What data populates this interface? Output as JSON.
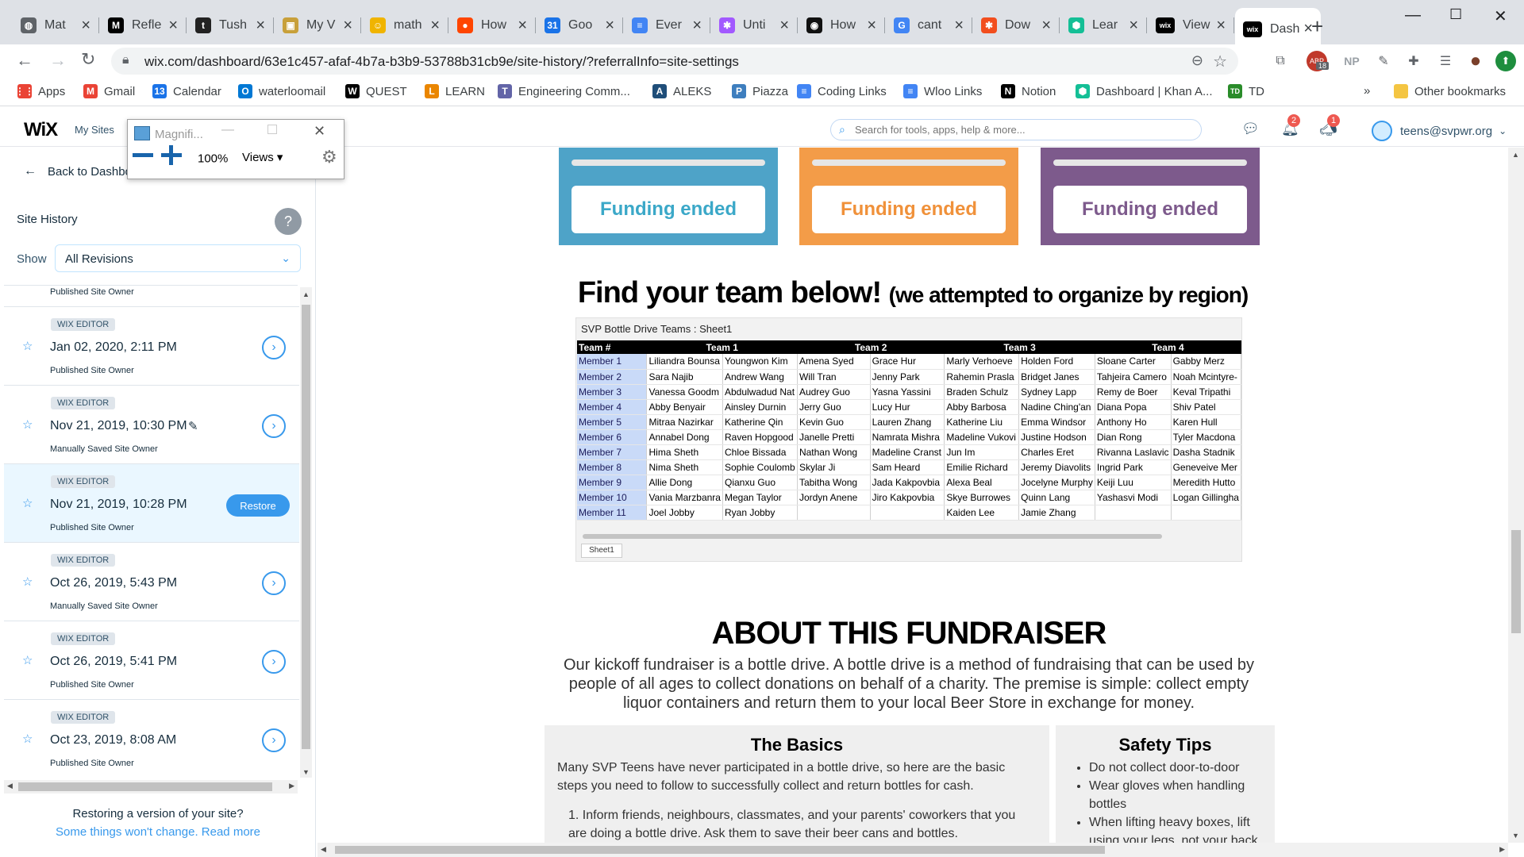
{
  "browser": {
    "tabs": [
      {
        "label": "Mat",
        "icon": "globe-icon",
        "color": "#5f6368",
        "glyph": "◍"
      },
      {
        "label": "Refle",
        "icon": "medium-icon",
        "color": "#000000",
        "glyph": "M"
      },
      {
        "label": "Tush",
        "icon": "tg-icon",
        "color": "#222222",
        "glyph": "t"
      },
      {
        "label": "My V",
        "icon": "photo-icon",
        "color": "#c8a03a",
        "glyph": "▣"
      },
      {
        "label": "math",
        "icon": "emoji-icon",
        "color": "#f0b400",
        "glyph": "☺"
      },
      {
        "label": "How",
        "icon": "reddit-icon",
        "color": "#ff4500",
        "glyph": "●"
      },
      {
        "label": "Goo",
        "icon": "calendar-icon",
        "color": "#1a73e8",
        "glyph": "31"
      },
      {
        "label": "Ever",
        "icon": "docs-icon",
        "color": "#4285f4",
        "glyph": "≡"
      },
      {
        "label": "Unti",
        "icon": "figma-icon",
        "color": "#a259ff",
        "glyph": "✱"
      },
      {
        "label": "How",
        "icon": "github-icon",
        "color": "#111111",
        "glyph": "◉"
      },
      {
        "label": "cant",
        "icon": "google-icon",
        "color": "#4285f4",
        "glyph": "G"
      },
      {
        "label": "Dow",
        "icon": "figma-icon",
        "color": "#f24e1e",
        "glyph": "✱"
      },
      {
        "label": "Lear",
        "icon": "khan-icon",
        "color": "#14bf96",
        "glyph": "⬢"
      },
      {
        "label": "View",
        "icon": "wix-icon",
        "color": "#000000",
        "glyph": "wix"
      },
      {
        "label": "Dash",
        "icon": "wix-icon",
        "color": "#000000",
        "glyph": "wix",
        "active": true
      }
    ],
    "url": "wix.com/dashboard/63e1c457-afaf-4b7a-b3b9-53788b31cb9e/site-history/?referralInfo=site-settings",
    "extensions": [
      {
        "name": "profile-icon",
        "glyph": "⧉"
      },
      {
        "name": "abp-icon",
        "glyph": "ABP",
        "badge": "18"
      },
      {
        "name": "np-icon",
        "glyph": "NP"
      },
      {
        "name": "pen-icon",
        "glyph": "✎"
      },
      {
        "name": "puzzle-icon",
        "glyph": "✚"
      },
      {
        "name": "reading-list-icon",
        "glyph": "☰"
      },
      {
        "name": "avatar-icon",
        "glyph": "●"
      },
      {
        "name": "update-icon",
        "glyph": "⬆"
      }
    ],
    "bookmarks": [
      {
        "label": "Apps",
        "icon": "apps-icon",
        "color": "#ea4335",
        "glyph": "⋮⋮"
      },
      {
        "label": "Gmail",
        "icon": "gmail-icon",
        "color": "#ea4335",
        "glyph": "M"
      },
      {
        "label": "Calendar",
        "icon": "calendar-icon",
        "color": "#1a73e8",
        "glyph": "13"
      },
      {
        "label": "waterloomail",
        "icon": "outlook-icon",
        "color": "#0078d4",
        "glyph": "O"
      },
      {
        "label": "QUEST",
        "icon": "w-icon",
        "color": "#000000",
        "glyph": "W"
      },
      {
        "label": "LEARN",
        "icon": "learn-icon",
        "color": "#ea8600",
        "glyph": "L"
      },
      {
        "label": "Engineering Comm...",
        "icon": "teams-icon",
        "color": "#6264a7",
        "glyph": "T"
      },
      {
        "label": "ALEKS",
        "icon": "aleks-icon",
        "color": "#1f4e79",
        "glyph": "A"
      },
      {
        "label": "Piazza",
        "icon": "piazza-icon",
        "color": "#3e7ebe",
        "glyph": "P"
      },
      {
        "label": "Coding Links",
        "icon": "docs-icon",
        "color": "#4285f4",
        "glyph": "≡"
      },
      {
        "label": "Wloo Links",
        "icon": "docs-icon",
        "color": "#4285f4",
        "glyph": "≡"
      },
      {
        "label": "Notion",
        "icon": "notion-icon",
        "color": "#000000",
        "glyph": "N"
      },
      {
        "label": "Dashboard | Khan A...",
        "icon": "khan-icon",
        "color": "#14bf96",
        "glyph": "⬢"
      },
      {
        "label": "TD",
        "icon": "td-icon",
        "color": "#2a8c2a",
        "glyph": "TD"
      }
    ],
    "other_bookmarks": "Other bookmarks"
  },
  "wix": {
    "logo": "WiX",
    "my_sites": "My Sites",
    "search_placeholder": "Search for tools, apps, help & more...",
    "notifications_badge": "2",
    "messages_badge": "1",
    "user": "teens@svpwr.org"
  },
  "left_panel": {
    "back": "Back to Dashboard",
    "title": "Site History",
    "help": "?",
    "show_label": "Show",
    "show_value": "All Revisions",
    "top_stub": "Published Site Owner",
    "revisions": [
      {
        "tag": "WIX EDITOR",
        "date": "Jan 02, 2020, 2:11 PM",
        "sub": "Published Site Owner",
        "action": "go"
      },
      {
        "tag": "WIX EDITOR",
        "date": "Nov 21, 2019, 10:30 PM",
        "sub": "Manually Saved Site Owner",
        "action": "go",
        "edit": true
      },
      {
        "tag": "WIX EDITOR",
        "date": "Nov 21, 2019, 10:28 PM",
        "sub": "Published Site Owner",
        "action": "restore",
        "highlight": true
      },
      {
        "tag": "WIX EDITOR",
        "date": "Oct 26, 2019, 5:43 PM",
        "sub": "Manually Saved Site Owner",
        "action": "go"
      },
      {
        "tag": "WIX EDITOR",
        "date": "Oct 26, 2019, 5:41 PM",
        "sub": "Published Site Owner",
        "action": "go"
      },
      {
        "tag": "WIX EDITOR",
        "date": "Oct 23, 2019, 8:08 AM",
        "sub": "Published Site Owner",
        "action": "go"
      }
    ],
    "restore_label": "Restore",
    "footer_q": "Restoring a version of your site?",
    "footer_link": "Some things won't change. Read more"
  },
  "magnifier": {
    "title": "Magnifi...",
    "zoom": "100%",
    "views": "Views ▾"
  },
  "page": {
    "funding": [
      {
        "label": "Funding ended",
        "color": "#4ea3c8",
        "text_color": "#3ba8c8"
      },
      {
        "label": "Funding ended",
        "color": "#f39c48",
        "text_color": "#f0913a"
      },
      {
        "label": "Funding ended",
        "color": "#7d5a8c",
        "text_color": "#7d5a8c"
      }
    ],
    "find_team": "Find your team below!",
    "find_team_note": "(we attempted to organize by region)",
    "sheet_title": "SVP Bottle Drive Teams : Sheet1",
    "sheet_tab": "Sheet1",
    "table": {
      "headers": [
        "Team #",
        "Team 1",
        "",
        "Team 2",
        "",
        "Team 3",
        "",
        "Team 4",
        ""
      ],
      "rows": [
        [
          "Member 1",
          "Liliandra Bounsa",
          "Youngwon Kim",
          "Amena Syed",
          "Grace Hur",
          "Marly Verhoeve",
          "Holden Ford",
          "Sloane Carter",
          "Gabby Merz"
        ],
        [
          "Member 2",
          "Sara Najib",
          "Andrew Wang",
          "Will Tran",
          "Jenny Park",
          "Rahemin Prasla",
          "Bridget Janes",
          "Tahjeira Camero",
          "Noah Mcintyre-"
        ],
        [
          "Member 3",
          "Vanessa Goodm",
          "Abdulwadud Nat",
          "Audrey Guo",
          "Yasna Yassini",
          "Braden Schulz",
          "Sydney Lapp",
          "Remy de Boer",
          "Keval Tripathi"
        ],
        [
          "Member 4",
          "Abby Benyair",
          "Ainsley Durnin",
          "Jerry Guo",
          "Lucy Hur",
          "Abby Barbosa",
          "Nadine Ching'an",
          "Diana Popa",
          "Shiv Patel"
        ],
        [
          "Member 5",
          "Mitraa Nazirkar",
          "Katherine Qin",
          "Kevin Guo",
          "Lauren Zhang",
          "Katherine Liu",
          "Emma Windsor",
          "Anthony Ho",
          "Karen Hull"
        ],
        [
          "Member 6",
          "Annabel Dong",
          "Raven Hopgood",
          "Janelle Pretti",
          "Namrata Mishra",
          "Madeline Vukovi",
          "Justine Hodson",
          "Dian Rong",
          "Tyler Macdona"
        ],
        [
          "Member 7",
          "Hima Sheth",
          "Chloe Bissada",
          "Nathan Wong",
          "Madeline Cranst",
          "Jun Im",
          "Charles Eret",
          "Rivanna Laslavic",
          "Dasha Stadnik"
        ],
        [
          "Member 8",
          "Nima Sheth",
          "Sophie Coulomb",
          "Skylar Ji",
          "Sam Heard",
          "Emilie Richard",
          "Jeremy Diavolits",
          "Ingrid Park",
          "Geneveive Mer"
        ],
        [
          "Member 9",
          "Allie Dong",
          "Qianxu Guo",
          "Tabitha Wong",
          "Jada Kakpovbia",
          "Alexa Beal",
          "Jocelyne Murphy",
          "Keiji Luu",
          "Meredith Hutto"
        ],
        [
          "Member 10",
          "Vania Marzbanra",
          "Megan Taylor",
          "Jordyn Anene",
          "Jiro Kakpovbia",
          "Skye Burrowes",
          "Quinn Lang",
          "Yashasvi Modi",
          "Logan Gillingha"
        ],
        [
          "Member 11",
          "Joel Jobby",
          "Ryan Jobby",
          "",
          "",
          "Kaiden Lee",
          "Jamie Zhang",
          "",
          ""
        ]
      ]
    },
    "about_title": "ABOUT THIS FUNDRAISER",
    "about_text": "Our kickoff fundraiser is a bottle drive. A bottle drive is a method of fundraising that can be used by people of all ages to collect donations on behalf of a charity. The premise is simple: collect empty liquor containers and return them to your local Beer Store in exchange for money.",
    "basics_title": "The Basics",
    "basics_text": "Many SVP Teens have never participated in a bottle drive, so here are the basic steps you need to follow to successfully collect and return bottles for cash.",
    "basics_list": "1. Inform friends, neighbours, classmates, and your parents' coworkers that you are doing a bottle drive. Ask them to save their beer cans and bottles.",
    "safety_title": "Safety Tips",
    "safety_items": [
      "Do not collect door-to-door",
      "Wear gloves when handling bottles",
      "When lifting heavy boxes, lift using your legs, not your back"
    ]
  }
}
